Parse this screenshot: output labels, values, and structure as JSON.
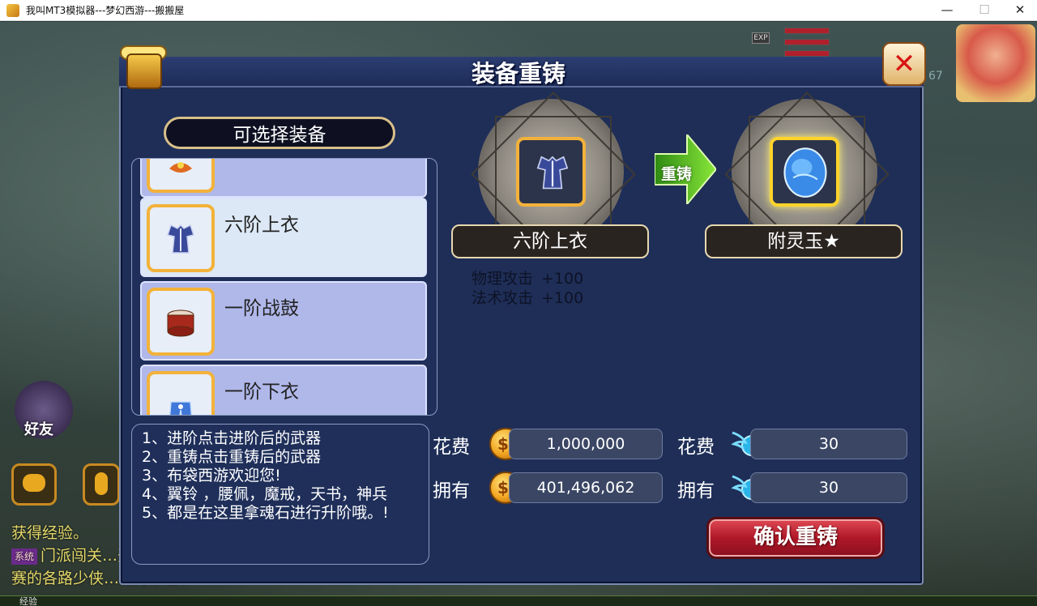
{
  "window": {
    "title": "我叫MT3模拟器---梦幻西游---搬搬屋",
    "minimize": "—",
    "maximize": "☐",
    "close": "✕"
  },
  "hud": {
    "exp_tag": "EXP",
    "level_hint": "67",
    "friend_label": "好友",
    "chat_lines": [
      "获得经验。",
      "门派闯关…开启，参",
      "赛的各路少侠…做好准备。"
    ],
    "exp_label": "经验"
  },
  "panel": {
    "title": "装备重铸",
    "close_glyph": "✕",
    "list_header": "可选择装备",
    "items": [
      {
        "name": "",
        "icon": "orange-accessory-icon"
      },
      {
        "name": "六阶上衣",
        "icon": "armor-top-icon",
        "selected": true
      },
      {
        "name": "一阶战鼓",
        "icon": "war-drum-icon"
      },
      {
        "name": "一阶下衣",
        "icon": "armor-bottom-icon"
      }
    ],
    "source_name": "六阶上衣",
    "target_name": "附灵玉★",
    "arrow_label": "重铸",
    "stats": [
      {
        "label": "物理攻击",
        "value": "+100"
      },
      {
        "label": "法术攻击",
        "value": "+100"
      }
    ],
    "notes": [
      "1、进阶点击进阶后的武器",
      "2、重铸点击重铸后的武器",
      "3、布袋西游欢迎您!",
      "4、翼铃 ，腰佩，魔戒，天书，神兵",
      "5、都是在这里拿魂石进行升阶哦。!"
    ],
    "cost_label": "花费",
    "own_label": "拥有",
    "gold_cost": "1,000,000",
    "gold_own": "401,496,062",
    "soul_cost": "30",
    "soul_own": "30",
    "confirm_label": "确认重铸"
  }
}
